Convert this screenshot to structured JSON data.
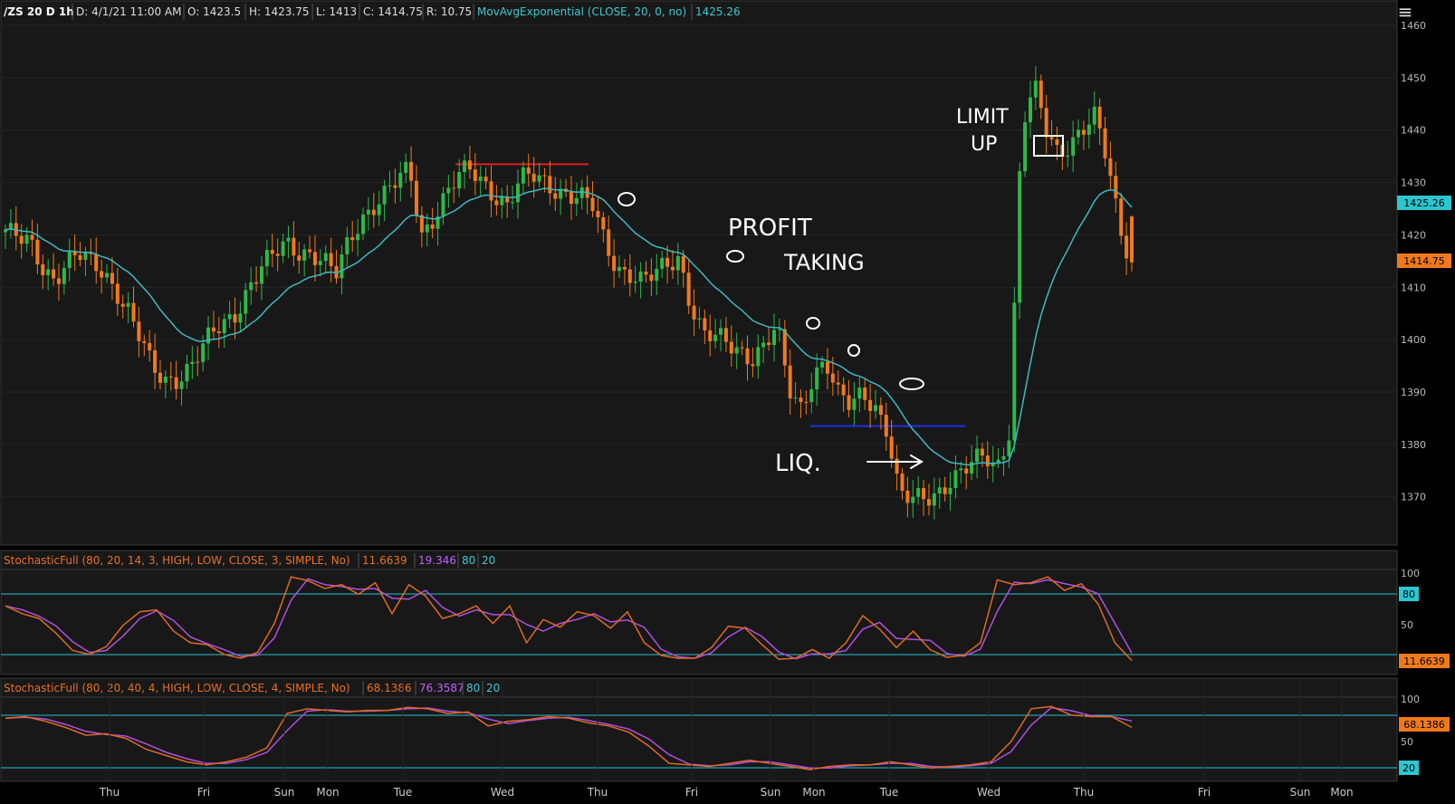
{
  "header": {
    "symbol": "/ZS 20 D 1h",
    "date": "D: 4/1/21 11:00 AM",
    "open": "O: 1423.5",
    "high": "H: 1423.75",
    "low": "L: 1413",
    "close": "C: 1414.75",
    "range": "R: 10.75",
    "study": "MovAvgExponential (CLOSE, 20, 0, no)",
    "study_value": "1425.26"
  },
  "price_axis": {
    "ticks": [
      "1460",
      "1450",
      "1440",
      "1430",
      "1420",
      "1410",
      "1400",
      "1390",
      "1380",
      "1370"
    ],
    "ma_tag": "1425.26",
    "last_tag": "1414.75"
  },
  "stoch1": {
    "label": "StochasticFull (80, 20, 14, 3, HIGH, LOW, CLOSE, 3, SIMPLE, No)",
    "k_value": "11.6639",
    "d_value": "19.346",
    "over": "80",
    "under": "20",
    "ticks": [
      "100",
      "50"
    ],
    "tag_over": "80",
    "tag_last": "11.6639"
  },
  "stoch2": {
    "label": "StochasticFull (80, 20, 40, 4, HIGH, LOW, CLOSE, 4, SIMPLE, No)",
    "k_value": "68.1386",
    "d_value": "76.3587",
    "over": "80",
    "under": "20",
    "ticks": [
      "100",
      "50"
    ],
    "tag_last": "68.1386",
    "tag_under": "20"
  },
  "x_axis": [
    "Thu",
    "Fri",
    "Sun",
    "Mon",
    "Tue",
    "Wed",
    "Thu",
    "Fri",
    "Sun",
    "Mon",
    "Tue",
    "Wed",
    "Thu",
    "Fri",
    "Sun",
    "Mon"
  ],
  "annotations": [
    "LIMIT UP",
    "PROFIT TAKING",
    "LIQ."
  ],
  "colors": {
    "up": "#2db84a",
    "down": "#f07a1a",
    "ema": "#3fb8c0",
    "stoch_k": "#e06a20",
    "stoch_d": "#b050e0",
    "level": "#2ac0d0",
    "resistance": "#e02020",
    "support": "#2030e0"
  },
  "chart_data": {
    "type": "candlestick",
    "symbol": "/ZS",
    "timeframe": "1h",
    "ylim": [
      1362,
      1460
    ],
    "ema_period": 20,
    "ema_last": 1425.26,
    "last_close": 1414.75,
    "last_bar": {
      "open": 1423.5,
      "high": 1423.75,
      "low": 1413,
      "close": 1414.75
    },
    "resistance_level": 1433.5,
    "support_level": 1383.5,
    "close_path": [
      1421,
      1419,
      1418,
      1414,
      1412,
      1415,
      1416,
      1414,
      1413,
      1410,
      1406,
      1400,
      1394,
      1392,
      1393,
      1395,
      1398,
      1401,
      1403,
      1406,
      1411,
      1414,
      1416,
      1418,
      1417,
      1417,
      1415,
      1412,
      1418,
      1423,
      1426,
      1428,
      1430,
      1432,
      1420,
      1424,
      1428,
      1431,
      1432,
      1430,
      1428,
      1426,
      1430,
      1431,
      1430,
      1429,
      1428,
      1427,
      1425,
      1418,
      1414,
      1413,
      1411,
      1412,
      1414,
      1416,
      1407,
      1401,
      1400,
      1399,
      1398,
      1397,
      1399,
      1402,
      1390,
      1387,
      1394,
      1396,
      1389,
      1387,
      1390,
      1388,
      1383,
      1370,
      1369,
      1370,
      1371,
      1373,
      1374,
      1376,
      1378,
      1376,
      1383,
      1440,
      1448,
      1440,
      1436,
      1438,
      1440,
      1442,
      1434,
      1422,
      1415
    ],
    "stoch1": {
      "k_last": 11.6639,
      "d_last": 19.346,
      "overbought": 80,
      "oversold": 20,
      "k_path": [
        68,
        60,
        55,
        40,
        22,
        18,
        26,
        48,
        62,
        64,
        42,
        30,
        28,
        18,
        14,
        20,
        50,
        98,
        94,
        86,
        90,
        80,
        92,
        60,
        90,
        78,
        55,
        60,
        68,
        50,
        68,
        30,
        54,
        46,
        62,
        58,
        45,
        62,
        30,
        17,
        14,
        14,
        25,
        47,
        45,
        28,
        13,
        14,
        23,
        14,
        30,
        58,
        44,
        25,
        42,
        23,
        15,
        17,
        30,
        95,
        90,
        92,
        98,
        84,
        91,
        70,
        30,
        13
      ]
    },
    "stoch2": {
      "k_last": 68.1386,
      "d_last": 76.3587,
      "overbought": 80,
      "oversold": 20,
      "k_path": [
        80,
        82,
        76,
        68,
        58,
        60,
        54,
        40,
        32,
        24,
        20,
        24,
        30,
        42,
        86,
        92,
        90,
        88,
        90,
        90,
        94,
        92,
        86,
        88,
        70,
        76,
        78,
        82,
        80,
        74,
        70,
        62,
        44,
        22,
        20,
        18,
        22,
        26,
        22,
        18,
        14,
        18,
        20,
        20,
        24,
        20,
        16,
        18,
        20,
        24,
        50,
        92,
        95,
        84,
        82,
        82,
        76
      ]
    }
  }
}
